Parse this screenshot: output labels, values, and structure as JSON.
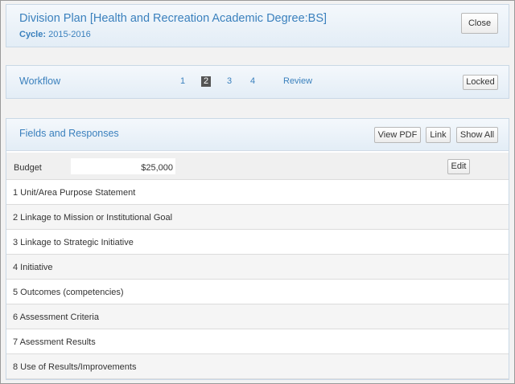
{
  "header": {
    "title": "Division Plan [Health and Recreation Academic Degree:BS]",
    "cycle_label": "Cycle:",
    "cycle_value": " 2015-2016",
    "close_label": "Close"
  },
  "workflow": {
    "title": "Workflow",
    "steps": [
      "1",
      "2",
      "3",
      "4",
      "Review"
    ],
    "active_step": "2",
    "locked_label": "Locked"
  },
  "fields": {
    "title": "Fields and Responses",
    "view_pdf_label": "View PDF",
    "link_label": "Link",
    "show_all_label": "Show All",
    "budget": {
      "label": "Budget",
      "value": "$25,000",
      "edit_label": "Edit"
    },
    "items": [
      "1 Unit/Area Purpose Statement",
      "2 Linkage to Mission or Institutional Goal",
      "3 Linkage to Strategic Initiative",
      "4 Initiative",
      "5 Outcomes (competencies)",
      "6 Assessment Criteria",
      "7 Asessment Results",
      "8 Use of Results/Improvements"
    ]
  },
  "colors": {
    "accent": "#3a80bd",
    "active_step_bg": "#555555"
  }
}
